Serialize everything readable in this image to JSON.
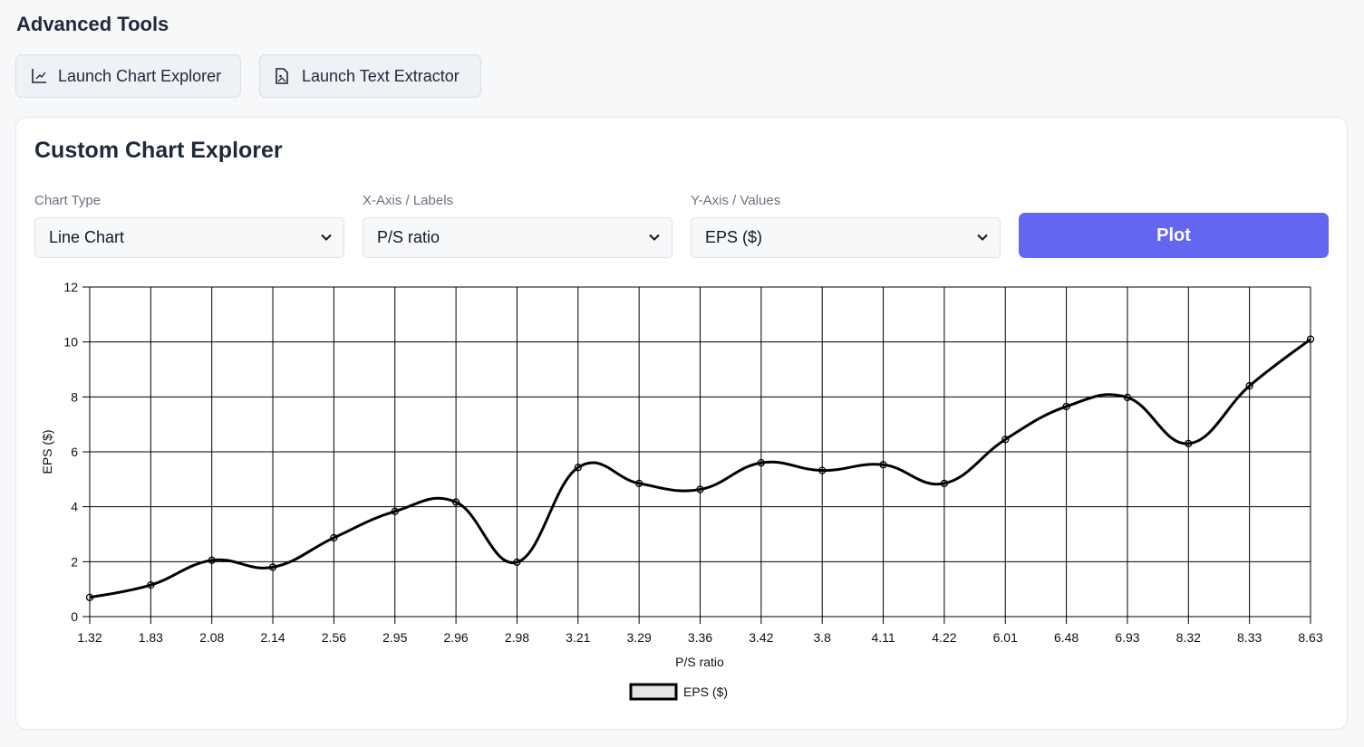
{
  "page": {
    "section_title": "Advanced Tools"
  },
  "tools": {
    "chart_explorer_label": "Launch Chart Explorer",
    "text_extractor_label": "Launch Text Extractor"
  },
  "panel": {
    "title": "Custom Chart Explorer",
    "chart_type_label": "Chart Type",
    "chart_type_value": "Line Chart",
    "x_axis_label": "X-Axis / Labels",
    "x_axis_value": "P/S ratio",
    "y_axis_label": "Y-Axis / Values",
    "y_axis_value": "EPS ($)",
    "plot_label": "Plot"
  },
  "chart_data": {
    "type": "line",
    "xlabel": "P/S ratio",
    "ylabel": "EPS ($)",
    "ylim": [
      0,
      12
    ],
    "yticks": [
      0,
      2,
      4,
      6,
      8,
      10,
      12
    ],
    "grid": true,
    "legend": "bottom-center",
    "series_color": "#000000",
    "categories": [
      "1.32",
      "1.83",
      "2.08",
      "2.14",
      "2.56",
      "2.95",
      "2.96",
      "2.98",
      "3.21",
      "3.29",
      "3.36",
      "3.42",
      "3.8",
      "4.11",
      "4.22",
      "6.01",
      "6.48",
      "6.93",
      "8.32",
      "8.33",
      "8.63"
    ],
    "series": [
      {
        "name": "EPS ($)",
        "values": [
          0.7,
          1.15,
          2.05,
          1.8,
          2.87,
          3.83,
          4.17,
          1.98,
          5.43,
          4.85,
          4.63,
          5.6,
          5.32,
          5.53,
          4.85,
          6.45,
          7.65,
          7.98,
          6.3,
          8.4,
          10.1
        ]
      }
    ]
  }
}
